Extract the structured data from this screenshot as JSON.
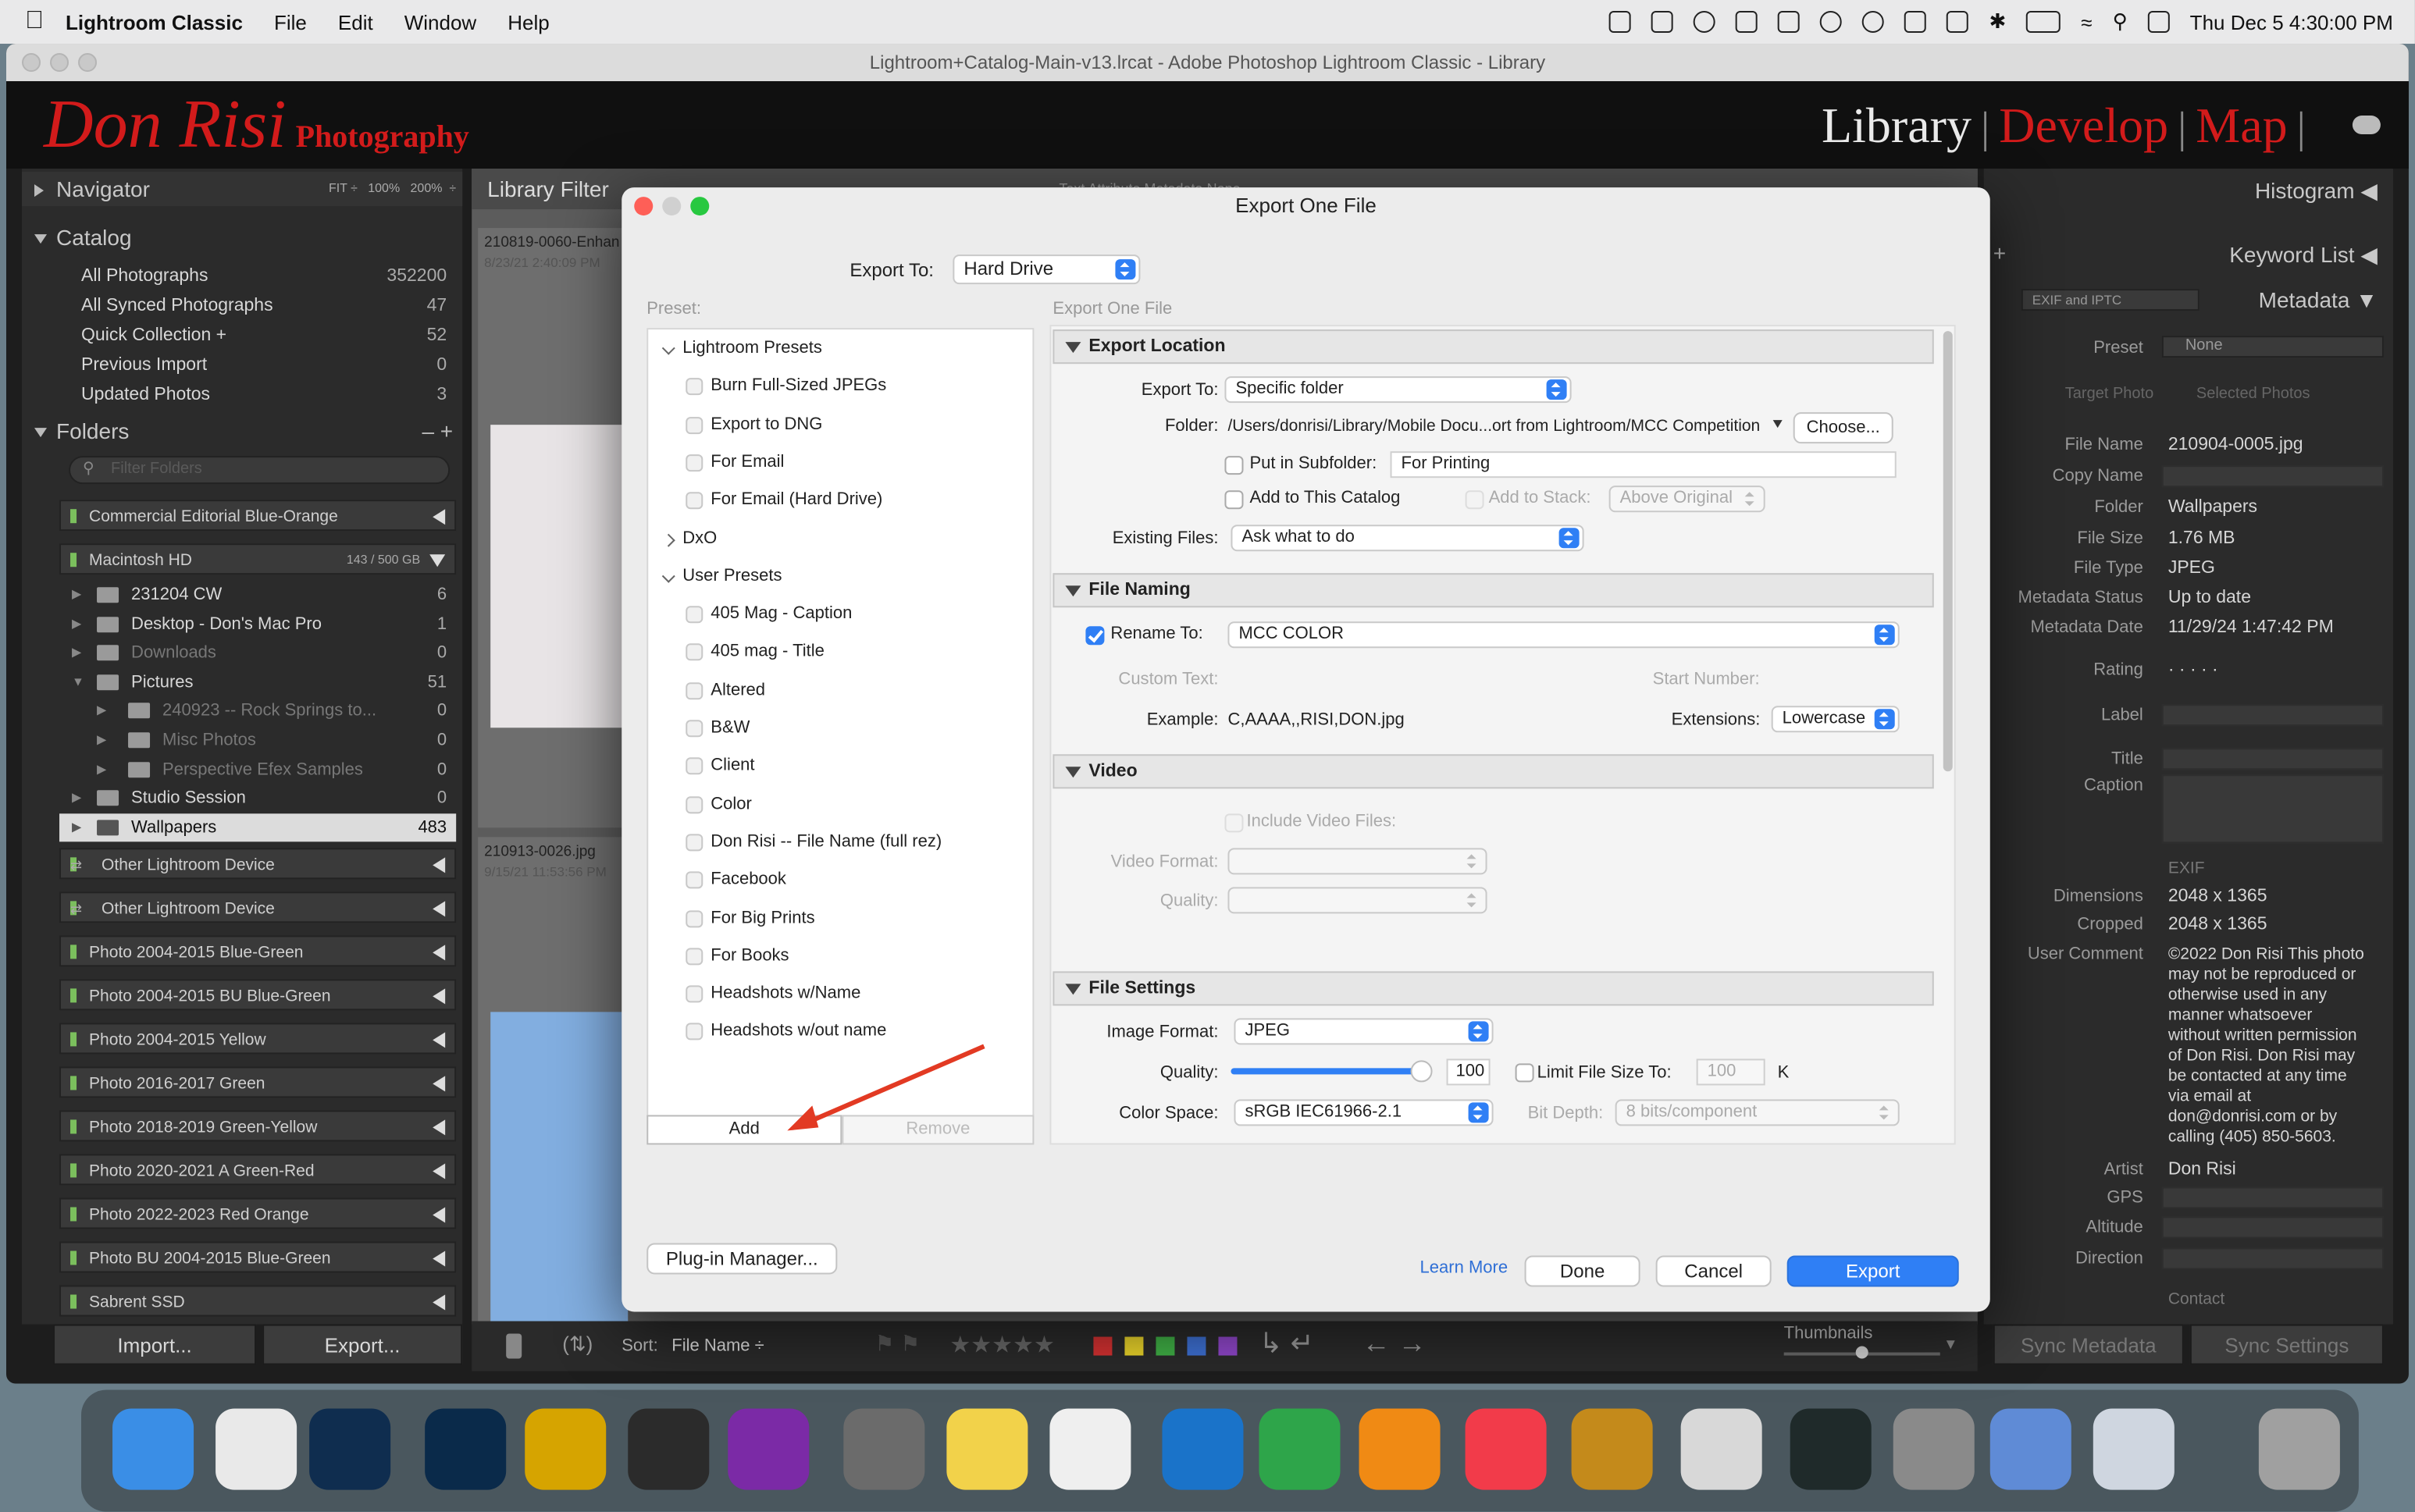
{
  "menubar": {
    "app": "Lightroom Classic",
    "items": [
      "File",
      "Edit",
      "Window",
      "Help"
    ],
    "clock": "Thu Dec 5  4:30:00 PM"
  },
  "window": {
    "title": "Lightroom+Catalog-Main-v13.lrcat - Adobe Photoshop Lightroom Classic - Library"
  },
  "identity": {
    "brand": "Don Risi",
    "brand_sub": "Photography",
    "modules": [
      "Library",
      "Develop",
      "Map"
    ]
  },
  "left": {
    "navigator": {
      "title": "Navigator",
      "zoom": [
        "FIT ÷",
        "100%",
        "200%",
        "÷"
      ]
    },
    "catalog": {
      "title": "Catalog",
      "rows": [
        {
          "label": "All Photographs",
          "n": "352200"
        },
        {
          "label": "All Synced Photographs",
          "n": "47"
        },
        {
          "label": "Quick Collection +",
          "n": "52"
        },
        {
          "label": "Previous Import",
          "n": "0"
        },
        {
          "label": "Updated Photos",
          "n": "3"
        }
      ]
    },
    "folders": {
      "title": "Folders",
      "filter_placeholder": "Filter Folders",
      "controls": "– +",
      "volumes_top": [
        {
          "label": "Commercial Editorial Blue-Orange"
        }
      ],
      "mac": {
        "label": "Macintosh HD",
        "info": "143 / 500 GB"
      },
      "rows": [
        {
          "label": "231204 CW",
          "n": "6"
        },
        {
          "label": "Desktop - Don's Mac Pro",
          "n": "1"
        },
        {
          "label": "Downloads",
          "n": "0"
        },
        {
          "label": "Pictures",
          "n": "51"
        },
        {
          "label": "240923 -- Rock Springs to...",
          "n": "0"
        },
        {
          "label": "Misc Photos",
          "n": "0"
        },
        {
          "label": "Perspective Efex Samples",
          "n": "0"
        },
        {
          "label": "Studio Session",
          "n": "0"
        },
        {
          "label": "Wallpapers",
          "n": "483"
        }
      ],
      "devices": [
        "Other Lightroom Device",
        "Other Lightroom Device"
      ],
      "volumes": [
        "Photo 2004-2015 Blue-Green",
        "Photo 2004-2015 BU Blue-Green",
        "Photo 2004-2015 Yellow",
        "Photo 2016-2017 Green",
        "Photo 2018-2019 Green-Yellow",
        "Photo 2020-2021 A Green-Red",
        "Photo 2022-2023 Red Orange",
        "Photo BU 2004-2015 Blue-Green",
        "Sabrent SSD"
      ]
    },
    "import_label": "Import...",
    "export_label": "Export..."
  },
  "center": {
    "filter_title": "Library Filter",
    "filter_tabs": "Text  Attribute  Metadata  None",
    "thumbs": [
      {
        "name": "210819-0060-Enhan",
        "date": "8/23/21 2:40:09 PM"
      },
      {
        "name": "210913-0026.jpg",
        "date": "9/15/21 11:53:56 PM"
      }
    ],
    "toolbar": {
      "sort_label": "Sort:",
      "sort_value": "File Name ÷",
      "thumbs_label": "Thumbnails"
    }
  },
  "right": {
    "histogram": "Histogram",
    "keyword": "Keyword List",
    "plus": "+",
    "metadata": "Metadata",
    "metadata_set": "EXIF and IPTC",
    "preset_label": "Preset",
    "preset_value": "None",
    "target": "Target Photo",
    "selected": "Selected Photos",
    "fields": [
      {
        "k": "File Name",
        "v": "210904-0005.jpg"
      },
      {
        "k": "Copy Name",
        "v": ""
      },
      {
        "k": "Folder",
        "v": "Wallpapers"
      },
      {
        "k": "File Size",
        "v": "1.76 MB"
      },
      {
        "k": "File Type",
        "v": "JPEG"
      },
      {
        "k": "Metadata Status",
        "v": "Up to date"
      },
      {
        "k": "Metadata Date",
        "v": "11/29/24 1:47:42 PM"
      },
      {
        "k": "Rating",
        "v": "· · · · ·"
      },
      {
        "k": "Label",
        "v": ""
      },
      {
        "k": "Title",
        "v": ""
      },
      {
        "k": "Caption",
        "v": ""
      }
    ],
    "exif_header": "EXIF",
    "exif": [
      {
        "k": "Dimensions",
        "v": "2048 x 1365"
      },
      {
        "k": "Cropped",
        "v": "2048 x 1365"
      },
      {
        "k": "User Comment",
        "v": "©2022 Don Risi  This photo may not be reproduced or otherwise used in any manner whatsoever without written permission of Don Risi. Don Risi may be contacted at any time via email at don@donrisi.com or by calling (405) 850-5603."
      },
      {
        "k": "Artist",
        "v": "Don Risi"
      },
      {
        "k": "GPS",
        "v": ""
      },
      {
        "k": "Altitude",
        "v": ""
      },
      {
        "k": "Direction",
        "v": ""
      }
    ],
    "contact": "Contact",
    "sync_metadata": "Sync Metadata",
    "sync_settings": "Sync Settings"
  },
  "dialog": {
    "title": "Export One File",
    "export_to_label": "Export To:",
    "export_to_value": "Hard Drive",
    "preset_label": "Preset:",
    "section_caption": "Export One File",
    "preset_groups": [
      {
        "label": "Lightroom Presets",
        "items": [
          "Burn Full-Sized JPEGs",
          "Export to DNG",
          "For Email",
          "For Email (Hard Drive)"
        ]
      },
      {
        "label": "DxO",
        "items": []
      },
      {
        "label": "User Presets",
        "items": [
          "405 Mag - Caption",
          "405 mag - Title",
          "Altered",
          "B&W",
          "Client",
          "Color",
          "Don Risi -- File Name (full rez)",
          "Facebook",
          "For Big Prints",
          "For Books",
          "Headshots w/Name",
          "Headshots w/out name"
        ]
      }
    ],
    "add_label": "Add",
    "remove_label": "Remove",
    "plugin_label": "Plug-in Manager...",
    "learn_more": "Learn More",
    "done": "Done",
    "cancel": "Cancel",
    "export": "Export",
    "location": {
      "title": "Export Location",
      "export_to_label": "Export To:",
      "export_to_value": "Specific folder",
      "folder_label": "Folder:",
      "folder_value": "/Users/donrisi/Library/Mobile Docu...ort from Lightroom/MCC Competition",
      "choose": "Choose...",
      "subfolder_label": "Put in Subfolder:",
      "subfolder_value": "For Printing",
      "add_catalog": "Add to This Catalog",
      "add_stack": "Add to Stack:",
      "stack_value": "Above Original",
      "existing_label": "Existing Files:",
      "existing_value": "Ask what to do"
    },
    "naming": {
      "title": "File Naming",
      "rename_label": "Rename To:",
      "rename_value": "MCC COLOR",
      "custom_label": "Custom Text:",
      "start_label": "Start Number:",
      "example_label": "Example:",
      "example_value": "C,AAAA,,RISI,DON.jpg",
      "ext_label": "Extensions:",
      "ext_value": "Lowercase"
    },
    "video": {
      "title": "Video",
      "include": "Include Video Files:",
      "format_label": "Video Format:",
      "quality_label": "Quality:"
    },
    "settings": {
      "title": "File Settings",
      "format_label": "Image Format:",
      "format_value": "JPEG",
      "quality_label": "Quality:",
      "quality_value": "100",
      "quality": 1.0,
      "limit_label": "Limit File Size To:",
      "limit_value": "100",
      "limit_unit": "K",
      "colorspace_label": "Color Space:",
      "colorspace_value": "sRGB IEC61966-2.1",
      "bitdepth_label": "Bit Depth:",
      "bitdepth_value": "8 bits/component"
    }
  },
  "colors": {
    "accent": "#2f7ff5",
    "brand": "#d21b1b",
    "arrow": "#e23a23"
  }
}
